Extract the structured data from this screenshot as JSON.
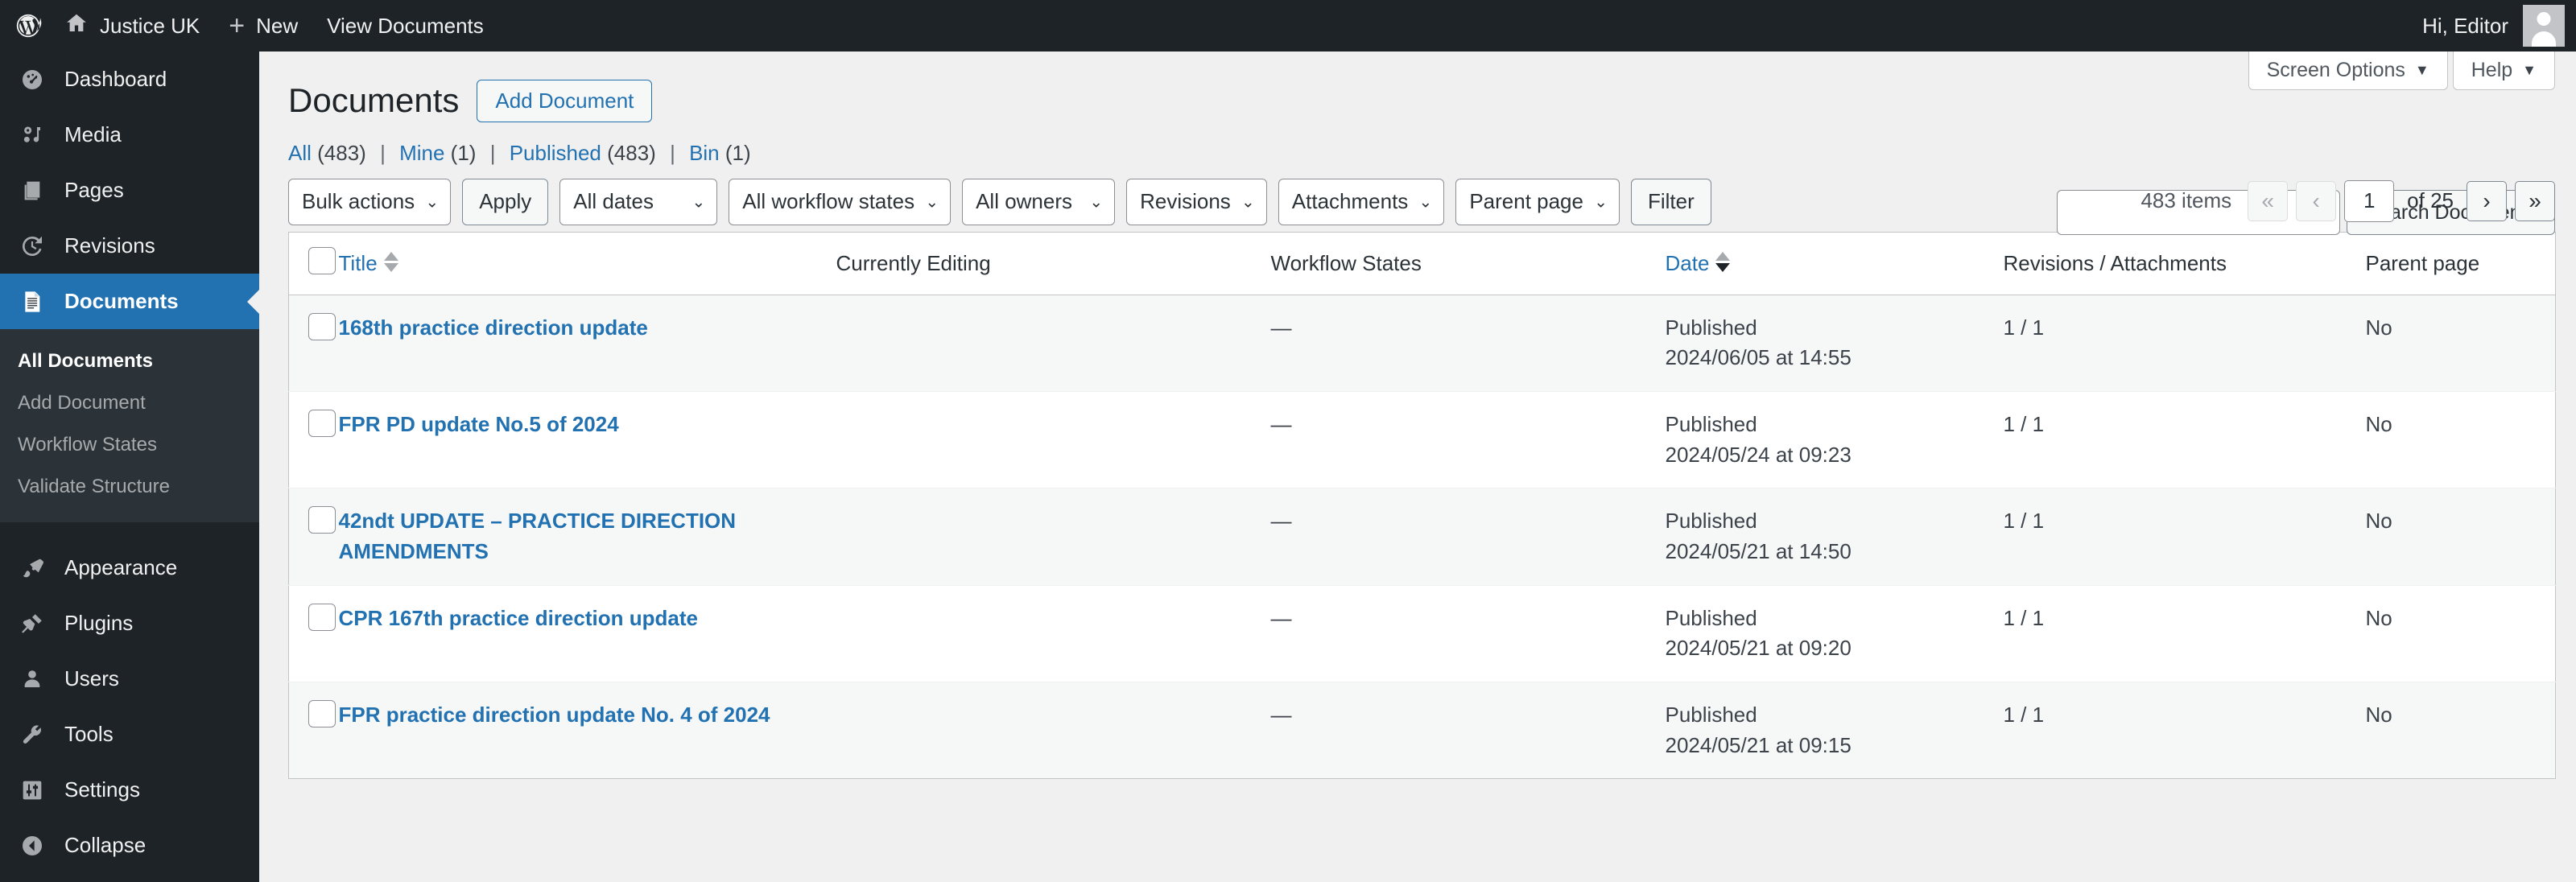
{
  "adminbar": {
    "logo_icon": "wordpress-logo-icon",
    "site_name": "Justice UK",
    "site_icon": "home-icon",
    "new_label": "New",
    "new_icon": "plus-icon",
    "view_label": "View Documents",
    "greeting": "Hi, Editor",
    "avatar_icon": "avatar-icon"
  },
  "sidebar": {
    "items": [
      {
        "label": "Dashboard",
        "icon": "dashboard-icon",
        "current": false
      },
      {
        "label": "Media",
        "icon": "media-icon",
        "current": false
      },
      {
        "label": "Pages",
        "icon": "pages-icon",
        "current": false
      },
      {
        "label": "Revisions",
        "icon": "revisions-clock-icon",
        "current": false
      },
      {
        "label": "Documents",
        "icon": "document-icon",
        "current": true
      },
      {
        "label": "Appearance",
        "icon": "paintbrush-icon",
        "current": false
      },
      {
        "label": "Plugins",
        "icon": "plug-icon",
        "current": false
      },
      {
        "label": "Users",
        "icon": "user-icon",
        "current": false
      },
      {
        "label": "Tools",
        "icon": "wrench-icon",
        "current": false
      },
      {
        "label": "Settings",
        "icon": "sliders-icon",
        "current": false
      },
      {
        "label": "Collapse",
        "icon": "collapse-icon",
        "current": false
      }
    ],
    "submenu": [
      {
        "label": "All Documents",
        "current": true
      },
      {
        "label": "Add Document",
        "current": false
      },
      {
        "label": "Workflow States",
        "current": false
      },
      {
        "label": "Validate Structure",
        "current": false
      }
    ]
  },
  "screen_meta": {
    "screen_options": "Screen Options",
    "help": "Help",
    "caret_icon": "caret-down-icon"
  },
  "header": {
    "title": "Documents",
    "add_button": "Add Document"
  },
  "views": [
    {
      "label": "All",
      "count": "(483)"
    },
    {
      "label": "Mine",
      "count": "(1)"
    },
    {
      "label": "Published",
      "count": "(483)"
    },
    {
      "label": "Bin",
      "count": "(1)"
    }
  ],
  "search": {
    "value": "",
    "placeholder": "",
    "submit_label": "Search Documents"
  },
  "tablenav": {
    "bulk_actions": "Bulk actions",
    "apply": "Apply",
    "all_dates": "All dates",
    "all_workflow_states": "All workflow states",
    "all_owners": "All owners",
    "revisions": "Revisions",
    "attachments": "Attachments",
    "parent_page": "Parent page",
    "filter": "Filter",
    "chevron_icon": "chevron-down-icon"
  },
  "pagination": {
    "items_label": "483 items",
    "first_icon": "«",
    "prev_icon": "‹",
    "current_page": "1",
    "total_label": "of 25",
    "next_icon": "›",
    "last_icon": "»"
  },
  "table": {
    "columns": [
      {
        "key": "cb",
        "label": ""
      },
      {
        "key": "title",
        "label": "Title",
        "sortable": true
      },
      {
        "key": "editing",
        "label": "Currently Editing",
        "sortable": false
      },
      {
        "key": "workflow",
        "label": "Workflow States",
        "sortable": false
      },
      {
        "key": "date",
        "label": "Date",
        "sortable": true,
        "sorted": "desc"
      },
      {
        "key": "rev",
        "label": "Revisions / Attachments",
        "sortable": false
      },
      {
        "key": "parent",
        "label": "Parent page",
        "sortable": false
      }
    ],
    "rows": [
      {
        "title": "168th practice direction update",
        "editing": "—",
        "workflow": "—",
        "date_status": "Published",
        "date_value": "2024/06/05 at 14:55",
        "rev": "1 / 1",
        "parent": "No"
      },
      {
        "title": "FPR PD update No.5 of 2024",
        "editing": "—",
        "workflow": "—",
        "date_status": "Published",
        "date_value": "2024/05/24 at 09:23",
        "rev": "1 / 1",
        "parent": "No"
      },
      {
        "title": "42ndt UPDATE – PRACTICE DIRECTION AMENDMENTS",
        "editing": "—",
        "workflow": "—",
        "date_status": "Published",
        "date_value": "2024/05/21 at 14:50",
        "rev": "1 / 1",
        "parent": "No"
      },
      {
        "title": "CPR 167th practice direction update",
        "editing": "—",
        "workflow": "—",
        "date_status": "Published",
        "date_value": "2024/05/21 at 09:20",
        "rev": "1 / 1",
        "parent": "No"
      },
      {
        "title": "FPR practice direction update No. 4 of 2024",
        "editing": "—",
        "workflow": "—",
        "date_status": "Published",
        "date_value": "2024/05/21 at 09:15",
        "rev": "1 / 1",
        "parent": "No"
      }
    ]
  },
  "colors": {
    "admin_bg": "#1d2327",
    "current_menu": "#2271b1",
    "link": "#2271b1",
    "page_bg": "#f0f0f1",
    "alt_row": "#f6f7f7"
  }
}
